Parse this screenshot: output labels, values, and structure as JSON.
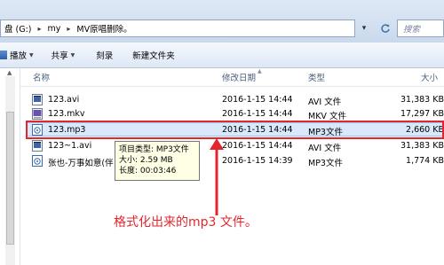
{
  "address": {
    "crumbs": [
      "盘 (G:)",
      "my",
      "MV原唱删除。"
    ],
    "search_placeholder": "搜索"
  },
  "toolbar": {
    "items": [
      "播放",
      "共享",
      "刻录",
      "新建文件夹"
    ]
  },
  "columns": {
    "name": "名称",
    "date": "修改日期",
    "type": "类型",
    "size": "大小"
  },
  "files": [
    {
      "name": "123.avi",
      "date": "2016-1-15 14:44",
      "type": "AVI 文件",
      "size": "31,383 KB",
      "icon": "avi-video-icon"
    },
    {
      "name": "123.mkv",
      "date": "2016-1-15 14:44",
      "type": "MKV 文件",
      "size": "17,297 KB",
      "icon": "mkv-video-icon"
    },
    {
      "name": "123.mp3",
      "date": "2016-1-15 14:44",
      "type": "MP3文件",
      "size": "2,660 KB",
      "icon": "mp3-audio-icon"
    },
    {
      "name": "123~1.avi",
      "date": "2016-1-15 14:44",
      "type": "AVI 文件",
      "size": "31,383 KB",
      "icon": "avi-video-icon"
    },
    {
      "name": "张也-万事如意(伴",
      "date": "2016-1-15 14:39",
      "type": "MP3文件",
      "size": "1,774 KB",
      "icon": "mp3-audio-icon"
    }
  ],
  "tooltip": {
    "line1": "项目类型: MP3文件",
    "line2": "大小: 2.59 MB",
    "line3": "长度: 00:03:46"
  },
  "annotation": "格式化出来的mp3 文件。",
  "colors": {
    "highlight": "#e3262b",
    "selection": "#d9e9fb"
  }
}
